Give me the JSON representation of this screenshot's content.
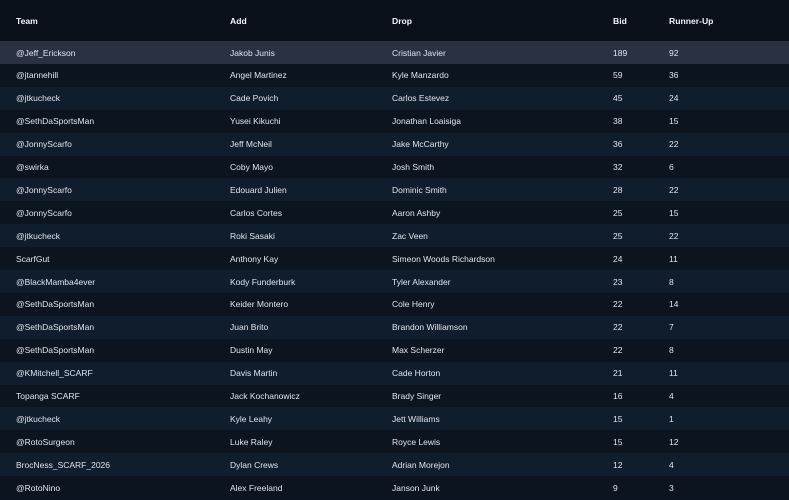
{
  "columns": {
    "team": "Team",
    "add": "Add",
    "drop": "Drop",
    "bid": "Bid",
    "runner_up": "Runner-Up"
  },
  "rows": [
    {
      "team": "@Jeff_Erickson",
      "add": "Jakob Junis",
      "drop": "Cristian Javier",
      "bid": "189",
      "runner_up": "92"
    },
    {
      "team": "@jtannehill",
      "add": "Angel Martinez",
      "drop": "Kyle Manzardo",
      "bid": "59",
      "runner_up": "36"
    },
    {
      "team": "@jtkucheck",
      "add": "Cade Povich",
      "drop": "Carlos Estevez",
      "bid": "45",
      "runner_up": "24"
    },
    {
      "team": "@SethDaSportsMan",
      "add": "Yusei Kikuchi",
      "drop": "Jonathan Loaisiga",
      "bid": "38",
      "runner_up": "15"
    },
    {
      "team": "@JonnyScarfo",
      "add": "Jeff McNeil",
      "drop": "Jake McCarthy",
      "bid": "36",
      "runner_up": "22"
    },
    {
      "team": "@swirka",
      "add": "Coby Mayo",
      "drop": "Josh Smith",
      "bid": "32",
      "runner_up": "6"
    },
    {
      "team": "@JonnyScarfo",
      "add": "Edouard Julien",
      "drop": "Dominic Smith",
      "bid": "28",
      "runner_up": "22"
    },
    {
      "team": "@JonnyScarfo",
      "add": "Carlos Cortes",
      "drop": "Aaron Ashby",
      "bid": "25",
      "runner_up": "15"
    },
    {
      "team": "@jtkucheck",
      "add": "Roki Sasaki",
      "drop": "Zac Veen",
      "bid": "25",
      "runner_up": "22"
    },
    {
      "team": "ScarfGut",
      "add": "Anthony Kay",
      "drop": "Simeon Woods Richardson",
      "bid": "24",
      "runner_up": "11"
    },
    {
      "team": "@BlackMamba4ever",
      "add": "Kody Funderburk",
      "drop": "Tyler Alexander",
      "bid": "23",
      "runner_up": "8"
    },
    {
      "team": "@SethDaSportsMan",
      "add": "Keider Montero",
      "drop": "Cole Henry",
      "bid": "22",
      "runner_up": "14"
    },
    {
      "team": "@SethDaSportsMan",
      "add": "Juan Brito",
      "drop": "Brandon Williamson",
      "bid": "22",
      "runner_up": "7"
    },
    {
      "team": "@SethDaSportsMan",
      "add": "Dustin May",
      "drop": "Max Scherzer",
      "bid": "22",
      "runner_up": "8"
    },
    {
      "team": "@KMitchell_SCARF",
      "add": "Davis Martin",
      "drop": "Cade Horton",
      "bid": "21",
      "runner_up": "11"
    },
    {
      "team": "Topanga SCARF",
      "add": "Jack Kochanowicz",
      "drop": "Brady Singer",
      "bid": "16",
      "runner_up": "4"
    },
    {
      "team": "@jtkucheck",
      "add": "Kyle Leahy",
      "drop": "Jett Williams",
      "bid": "15",
      "runner_up": "1"
    },
    {
      "team": "@RotoSurgeon",
      "add": "Luke Raley",
      "drop": "Royce Lewis",
      "bid": "15",
      "runner_up": "12"
    },
    {
      "team": "BrocNess_SCARF_2026",
      "add": "Dylan Crews",
      "drop": "Adrian Morejon",
      "bid": "12",
      "runner_up": "4"
    },
    {
      "team": "@RotoNino",
      "add": "Alex Freeland",
      "drop": "Janson Junk",
      "bid": "9",
      "runner_up": "3"
    }
  ]
}
